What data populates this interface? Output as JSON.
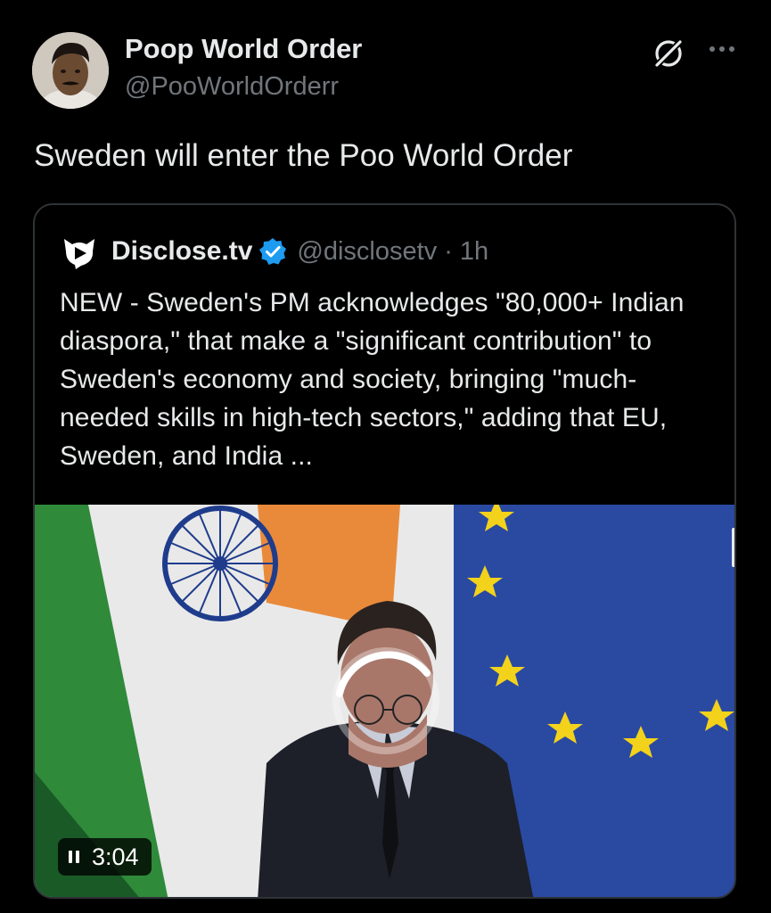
{
  "author": {
    "display_name": "Poop World Order",
    "handle": "@PooWorldOrderr",
    "avatar_icon": "user-avatar"
  },
  "tweet": {
    "text": "Sweden will enter the Poo World Order"
  },
  "header_icons": {
    "grok": "grok-icon",
    "more": "more-icon"
  },
  "quote": {
    "logo_icon": "disclose-tv-logo",
    "name": "Disclose.tv",
    "verified": "verified-icon",
    "handle": "@disclosetv",
    "separator": "·",
    "time": "1h",
    "text": "NEW - Sweden's PM acknowledges \"80,000+ Indian diaspora,\" that make a \"significant contribution\" to Sweden's economy and society, bringing \"much-needed skills in high-tech sectors,\" adding that EU, Sweden, and India ..."
  },
  "video": {
    "duration": "3:04",
    "state_icon": "pause-icon",
    "loading_icon": "loading-spinner-icon"
  },
  "colors": {
    "background": "#000000",
    "text_primary": "#e7e9ea",
    "text_secondary": "#71767b",
    "border": "#2f3336",
    "verified_blue": "#1d9bf0"
  }
}
